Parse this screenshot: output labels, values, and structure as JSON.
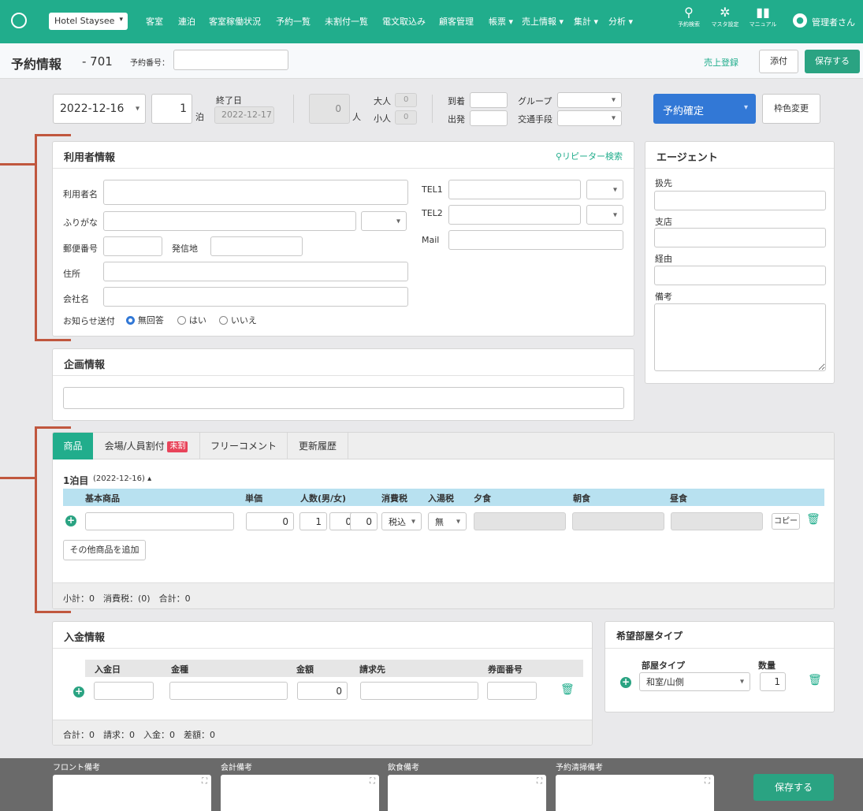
{
  "nav": {
    "hotel": "Hotel Staysee",
    "items": [
      "客室",
      "連泊",
      "客室稼働状況",
      "予約一覧",
      "未割付一覧",
      "電文取込み",
      "顧客管理",
      "帳票 ▾",
      "売上情報 ▾",
      "集計 ▾",
      "分析 ▾"
    ],
    "icons": [
      {
        "icon": "search-icon",
        "label": "予約検索"
      },
      {
        "icon": "gear-icon",
        "label": "マスタ設定"
      },
      {
        "icon": "book-icon",
        "label": "マニュアル"
      }
    ],
    "user": "管理者さん"
  },
  "header": {
    "title": "予約情報",
    "room": "- 701",
    "resno_label": "予約番号：",
    "resno_value": "",
    "sales_link": "売上登録",
    "attach": "添付",
    "save": "保存する"
  },
  "booking": {
    "start_date": "2022-12-16",
    "nights": "1",
    "nights_unit": "泊",
    "end_label": "終了日",
    "end_date": "2022-12-17",
    "people": "0",
    "people_unit": "人",
    "adult_label": "大人",
    "adult_value": "0",
    "child_label": "小人",
    "child_value": "0",
    "arrive_label": "到着",
    "depart_label": "出発",
    "group_label": "グループ",
    "transport_label": "交通手段",
    "status": "予約確定",
    "color_change": "枠色変更"
  },
  "guest": {
    "title": "利用者情報",
    "repeater_search": "リピーター検索",
    "name": "利用者名",
    "kana": "ふりがな",
    "zip": "郵便番号",
    "origin": "発信地",
    "address": "住所",
    "company": "会社名",
    "tel1": "TEL1",
    "tel2": "TEL2",
    "mail": "Mail",
    "notify_label": "お知らせ送付",
    "notify_options": [
      "無回答",
      "はい",
      "いいえ"
    ]
  },
  "agent": {
    "title": "エージェント",
    "handler": "扱先",
    "branch": "支店",
    "via": "経由",
    "note": "備考"
  },
  "plan": {
    "title": "企画情報"
  },
  "tabs": {
    "items": [
      "商品",
      "会場/人員割付",
      "フリーコメント",
      "更新履歴"
    ],
    "badge": "未割"
  },
  "product": {
    "day_label": "1泊目",
    "day_date": "(2022-12-16)",
    "headers": [
      "基本商品",
      "単価",
      "人数(男/女)",
      "消費税",
      "入湯税",
      "夕食",
      "朝食",
      "昼食"
    ],
    "unit_price": "0",
    "count": "1",
    "male": "0",
    "female": "0",
    "tax": "税込",
    "bath_tax": "無",
    "copy": "コピー",
    "add_other": "その他商品を追加",
    "summary": "小計：0　消費税：(0)　合計：0"
  },
  "payment": {
    "title": "入金情報",
    "headers": [
      "入金日",
      "金種",
      "金額",
      "請求先",
      "券面番号"
    ],
    "amount": "0",
    "summary": "合計：0　請求：0　入金：0　差額：0"
  },
  "roomtype": {
    "title": "希望部屋タイプ",
    "type_label": "部屋タイプ",
    "qty_label": "数量",
    "type_value": "和室/山側",
    "qty_value": "1"
  },
  "footer": {
    "memos": [
      "フロント備考",
      "会計備考",
      "飲食備考",
      "予約清掃備考"
    ],
    "save": "保存する"
  }
}
